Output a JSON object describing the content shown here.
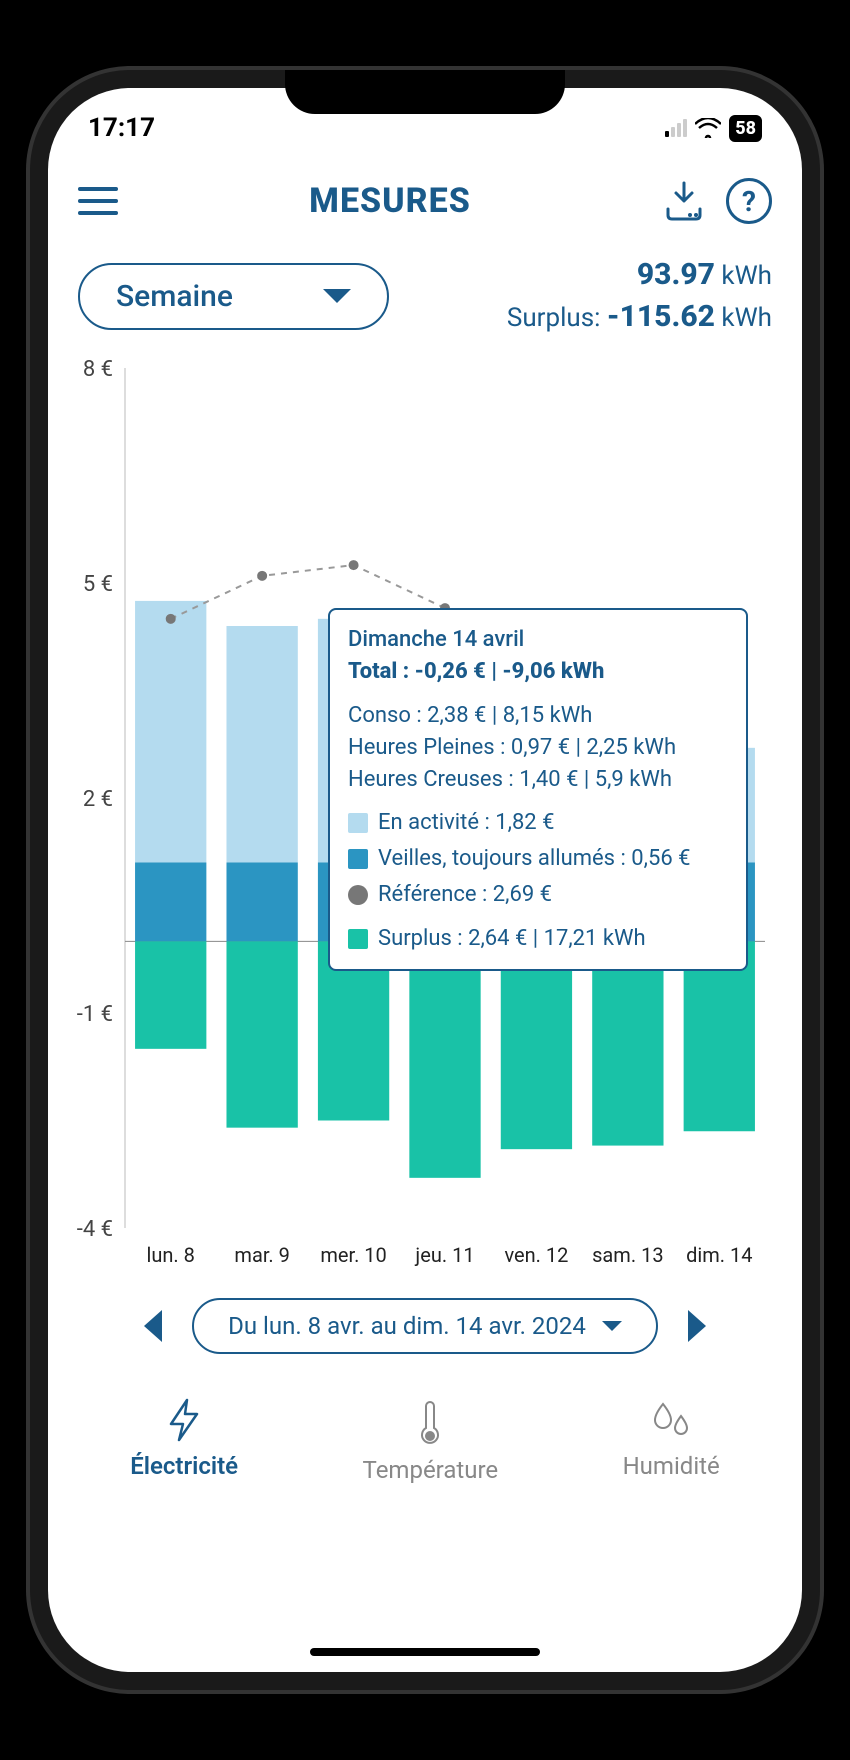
{
  "status": {
    "time": "17:17",
    "battery": "58"
  },
  "header": {
    "title": "MESURES"
  },
  "period": {
    "selected": "Semaine"
  },
  "totals": {
    "kwh_value": "93.97",
    "kwh_unit": "kWh",
    "surplus_label": "Surplus:",
    "surplus_value": "-115.62",
    "surplus_unit": "kWh"
  },
  "tooltip": {
    "date": "Dimanche 14 avril",
    "total_label": "Total :",
    "total_value": "-0,26 € | -9,06 kWh",
    "conso": "Conso : 2,38 € | 8,15 kWh",
    "hp": "Heures Pleines : 0,97 € | 2,25 kWh",
    "hc": "Heures Creuses : 1,40 € | 5,9 kWh",
    "active": "En activité : 1,82 €",
    "standby": "Veilles, toujours allumés : 0,56 €",
    "reference": "Référence : 2,69 €",
    "surplus": "Surplus : 2,64 € | 17,21 kWh"
  },
  "date_nav": {
    "label": "Du lun. 8 avr. au dim. 14 avr. 2024"
  },
  "tabs": {
    "elec": "Électricité",
    "temp": "Température",
    "humid": "Humidité"
  },
  "chart_data": {
    "type": "bar",
    "title": "",
    "xlabel": "",
    "ylabel": "€",
    "ylim": [
      -4,
      8
    ],
    "y_ticks": [
      "8 €",
      "5 €",
      "2 €",
      "-1 €",
      "-4 €"
    ],
    "categories": [
      "lun. 8",
      "mar. 9",
      "mer. 10",
      "jeu. 11",
      "ven. 12",
      "sam. 13",
      "dim. 14"
    ],
    "series": [
      {
        "name": "En activité",
        "color": "#b4dbef",
        "values": [
          3.65,
          3.3,
          3.4,
          1.3,
          1.4,
          1.6,
          1.6
        ]
      },
      {
        "name": "Veilles, toujours allumés",
        "color": "#2b95c2",
        "values": [
          1.1,
          1.1,
          1.1,
          1.1,
          1.1,
          1.1,
          1.1
        ]
      },
      {
        "name": "Surplus",
        "color": "#19c2a7",
        "values": [
          -1.5,
          -2.6,
          -2.5,
          -3.3,
          -2.9,
          -2.85,
          -2.65
        ]
      }
    ],
    "reference_line": {
      "name": "Référence",
      "color": "#777",
      "values": [
        4.5,
        5.1,
        5.25,
        4.65,
        3.9,
        2.85,
        2.7
      ]
    }
  }
}
